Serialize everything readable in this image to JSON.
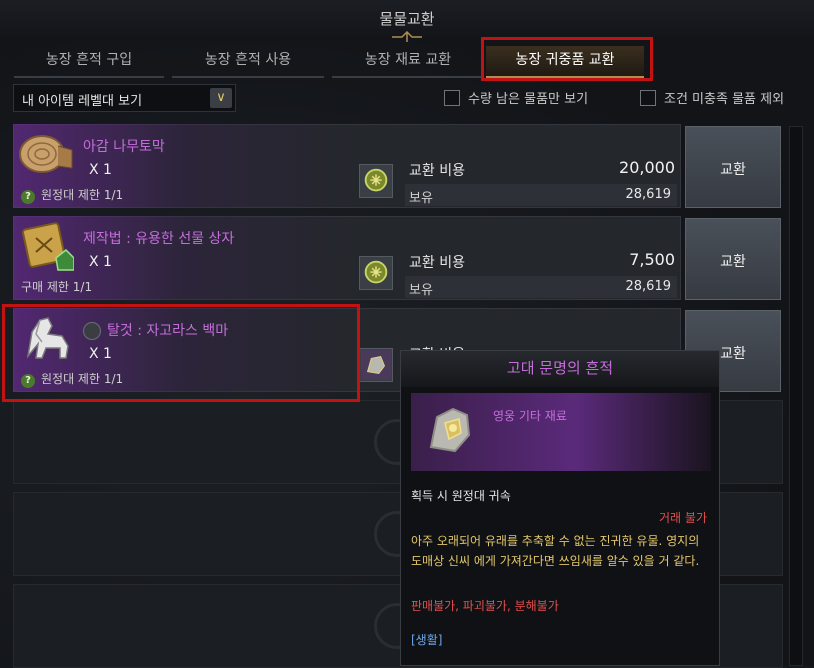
{
  "window": {
    "title": "물물교환"
  },
  "tabs": [
    {
      "label": "농장 흔적 구입"
    },
    {
      "label": "농장 흔적 사용"
    },
    {
      "label": "농장 재료 교환"
    },
    {
      "label": "농장 귀중품 교환",
      "active": true
    }
  ],
  "filter": {
    "dropdown_value": "내 아이템 레벨대 보기",
    "checkbox1": "수량 남은 물품만 보기",
    "checkbox2": "조건 미충족 물품 제외"
  },
  "items": [
    {
      "name": "아감 나무토막",
      "qty": "X 1",
      "limit": "원정대 제한 1/1",
      "cost_label": "교환 비용",
      "cost_value": "20,000",
      "own_label": "보유",
      "own_value": "28,619",
      "button": "교환",
      "icon": "wood-log-icon"
    },
    {
      "name": "제작법 : 유용한 선물 상자",
      "qty": "X 1",
      "limit": "구매 제한 1/1",
      "cost_label": "교환 비용",
      "cost_value": "7,500",
      "own_label": "보유",
      "own_value": "28,619",
      "button": "교환",
      "icon": "recipe-scroll-icon"
    },
    {
      "name": "탈것 : 자고라스 백마",
      "qty": "X 1",
      "limit": "원정대 제한 1/1",
      "cost_label": "교환 비용",
      "cost_value": "",
      "own_label": "",
      "own_value": "",
      "button": "교환",
      "icon": "white-horse-icon"
    }
  ],
  "tooltip": {
    "title": "고대 문명의 흔적",
    "category": "영웅 기타 재료",
    "bind": "획득 시 원정대 귀속",
    "trade": "거래 불가",
    "desc": "아주 오래되어 유래를 추축할 수 없는 진귀한 유물. 영지의 도매상 신씨 에게 가져간다면 쓰임새를 알수 있을 거 같다.",
    "restrictions": "판매불가, 파괴불가, 분해불가",
    "tag": "[생활]"
  },
  "colors": {
    "accent_purple": "#c66ddc",
    "highlight_red": "#c21212",
    "gold": "#e3c76a"
  }
}
